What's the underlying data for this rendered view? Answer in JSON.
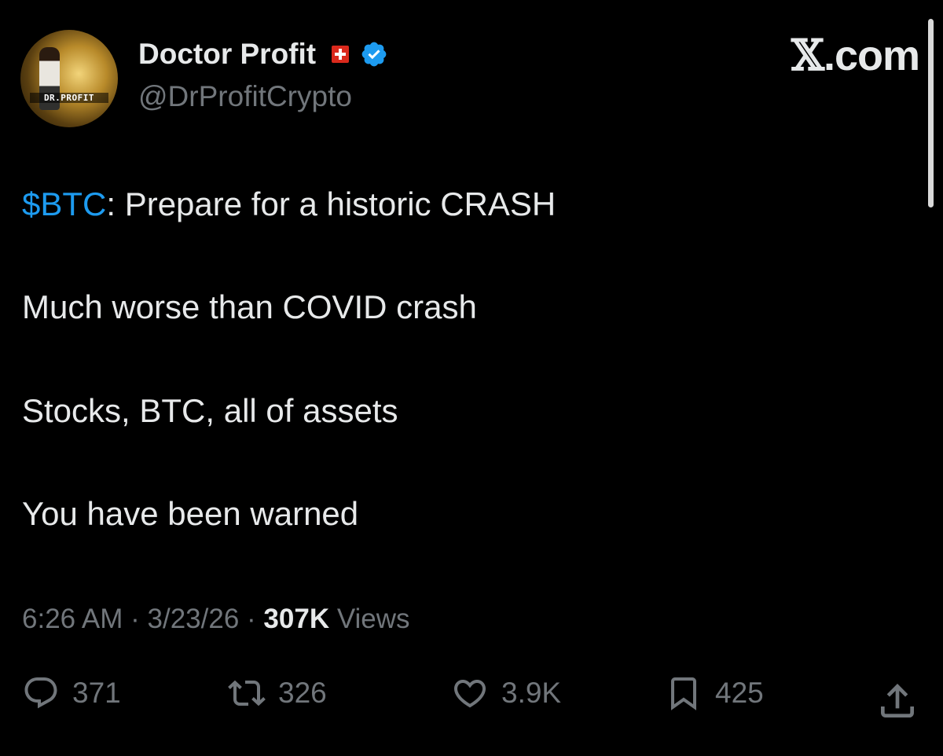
{
  "author": {
    "display_name": "Doctor Profit",
    "handle": "@DrProfitCrypto",
    "avatar_text": "DR.PROFIT",
    "flag_icon": "swiss-flag-icon",
    "verified_icon": "verified-badge-icon"
  },
  "brand": {
    "label_x": "𝕏",
    "label_rest": ".com"
  },
  "tweet": {
    "cashtag": "$BTC",
    "line1_rest": ": Prepare for a historic CRASH",
    "line2": "Much worse than COVID crash",
    "line3": "Stocks, BTC, all of assets",
    "line4": "You have been warned"
  },
  "meta": {
    "time": "6:26 AM",
    "sep1": " · ",
    "date": "3/23/26",
    "sep2": " · ",
    "views_count": "307K",
    "views_label": " Views"
  },
  "actions": {
    "replies": "371",
    "reposts": "326",
    "likes": "3.9K",
    "bookmarks": "425"
  },
  "colors": {
    "background": "#000000",
    "text": "#e7e9ea",
    "muted": "#71767b",
    "accent": "#1d9bf0"
  }
}
